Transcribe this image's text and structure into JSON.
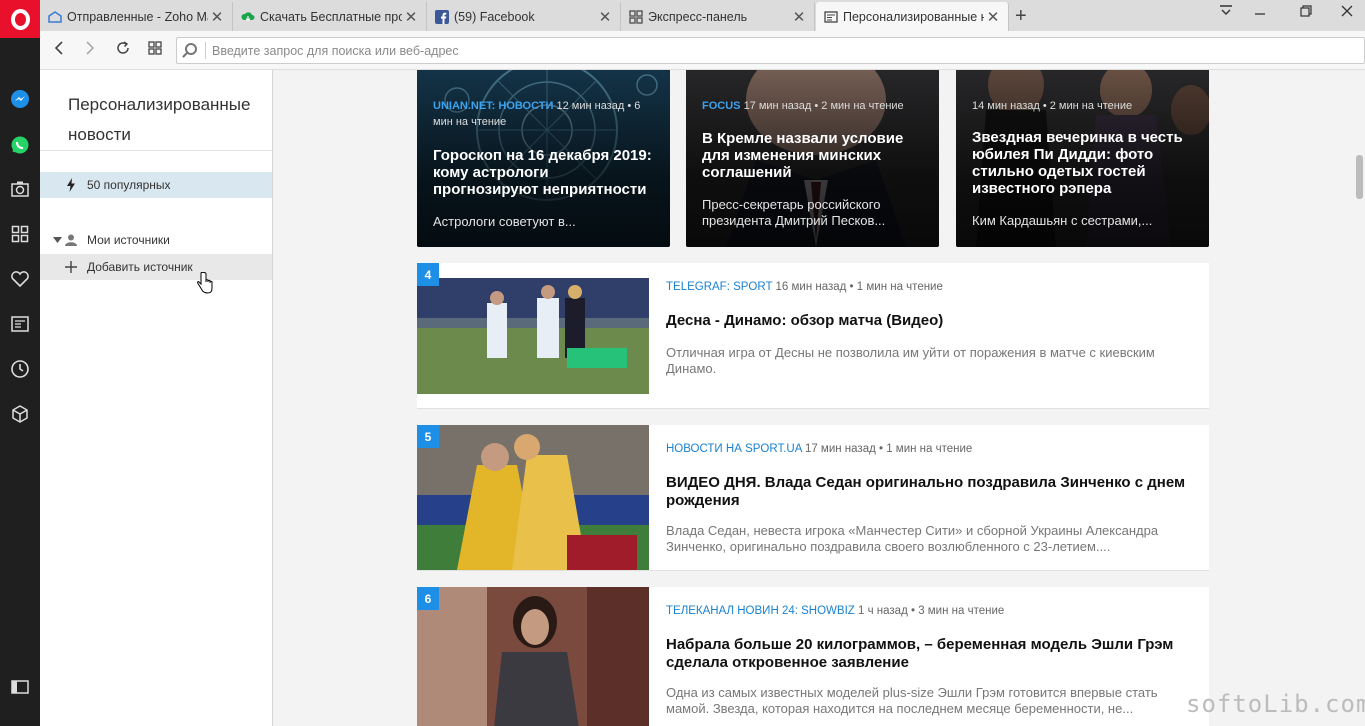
{
  "tabs": [
    {
      "title": "Отправленные - Zoho Ma",
      "icon": "zoho-mail-icon"
    },
    {
      "title": "Скачать Бесплатные прог",
      "icon": "download-cloud-icon"
    },
    {
      "title": "(59) Facebook",
      "icon": "facebook-icon"
    },
    {
      "title": "Экспресс-панель",
      "icon": "speed-dial-icon"
    },
    {
      "title": "Персонализированные н",
      "icon": "news-icon"
    }
  ],
  "address_bar": {
    "placeholder": "Введите запрос для поиска или веб-адрес"
  },
  "panel": {
    "title": "Персонализированные новости",
    "items": [
      {
        "label": "50 популярных",
        "icon": "bolt-icon"
      },
      {
        "label": "Мои источники",
        "icon": "person-icon"
      },
      {
        "label": "Добавить источник",
        "icon": "plus-icon"
      }
    ]
  },
  "cards": [
    {
      "source": "UNIAN.NET: НОВОСТИ",
      "meta": "12 мин назад • 6 мин на чтение",
      "title": "Гороскоп на 16 декабря 2019: кому астрологи прогнозируют неприятности",
      "desc": "Астрологи советуют в..."
    },
    {
      "source": "FOCUS",
      "meta": "17 мин назад • 2 мин на чтение",
      "title": "В Кремле назвали условие для изменения минских соглашений",
      "desc": "Пресс-секретарь российского президента Дмитрий Песков..."
    },
    {
      "source": "",
      "meta": "14 мин назад • 2 мин на чтение",
      "title": "Звездная вечеринка в честь юбилея Пи Дидди: фото стильно одетых гостей известного рэпера",
      "desc": "Ким Кардашьян с сестрами,..."
    }
  ],
  "rows": [
    {
      "num": "4",
      "source": "TELEGRAF: SPORT",
      "meta": "16 мин назад • 1 мин на чтение",
      "title": "Десна - Динамо: обзор матча (Видео)",
      "desc": "Отличная игра от Десны не позволила им уйти от поражения в матче с киевским Динамо."
    },
    {
      "num": "5",
      "source": "НОВОСТИ НА SPORT.UA",
      "meta": "17 мин назад • 1 мин на чтение",
      "title": "ВИДЕО ДНЯ. Влада Седан оригинально поздравила Зинченко с днем рождения",
      "desc": "Влада Седан, невеста игрока «Манчестер Сити» и сборной Украины Александра Зинченко, оригинально поздравила своего возлюбленного с 23-летием...."
    },
    {
      "num": "6",
      "source": "ТЕЛЕКАНАЛ НОВИН 24: SHOWBIZ",
      "meta": "1 ч назад • 3 мин на чтение",
      "title": "Набрала больше 20 килограммов, – беременная модель Эшли Грэм сделала откровенное заявление",
      "desc": "Одна из самых известных моделей plus-size Эшли Грэм готовится впервые стать мамой. Звезда, которая находится на последнем месяце беременности, не..."
    }
  ],
  "watermark": "softoLib.com"
}
